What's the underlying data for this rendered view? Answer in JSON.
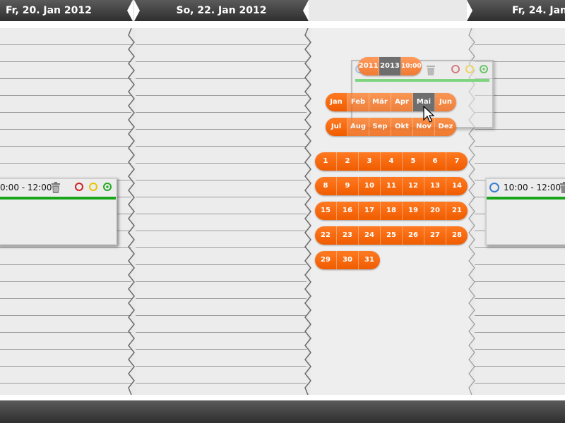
{
  "dates": {
    "col1": "Fr, 20. Jan 2012",
    "col2": "So, 22. Jan 2012",
    "col3": "",
    "col4": "Fr, 24. Jan"
  },
  "events": {
    "left": {
      "time": "0:00 - 12:00"
    },
    "right": {
      "time": "10:00 - 12:00"
    }
  },
  "ghost": {
    "year_cells": [
      "2011",
      "2013"
    ],
    "time": "10:00 - 12:00"
  },
  "months": {
    "row1": [
      "Jan",
      "Feb",
      "Mär",
      "Apr",
      "Mai",
      "Jun"
    ],
    "row2": [
      "Jul",
      "Aug",
      "Sep",
      "Okt",
      "Nov",
      "Dez"
    ],
    "selected": "Mai"
  },
  "days": {
    "row1": [
      "1",
      "2",
      "3",
      "4",
      "5",
      "6",
      "7"
    ],
    "row2": [
      "8",
      "9",
      "10",
      "11",
      "12",
      "13",
      "14"
    ],
    "row3": [
      "15",
      "16",
      "17",
      "18",
      "19",
      "20",
      "21"
    ],
    "row4": [
      "22",
      "23",
      "24",
      "25",
      "26",
      "27",
      "28"
    ],
    "row5": [
      "29",
      "30",
      "31"
    ]
  },
  "colors": {
    "accent": "#f26a10",
    "status_green": "#19a519",
    "circle_red": "#cc2222",
    "circle_yellow": "#e8c400",
    "circle_green": "#22aa22",
    "header_dark": "#3a3a3a"
  }
}
